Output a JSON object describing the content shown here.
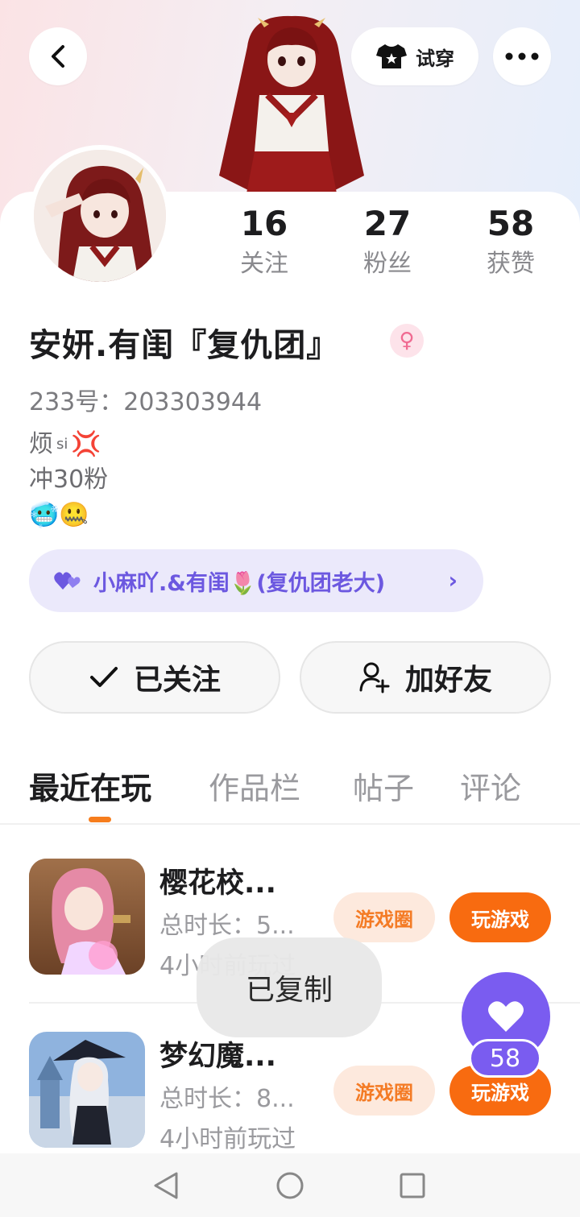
{
  "header": {
    "try_on_label": "试穿"
  },
  "stats": [
    {
      "value": "16",
      "label": "关注"
    },
    {
      "value": "27",
      "label": "粉丝"
    },
    {
      "value": "58",
      "label": "获赞"
    }
  ],
  "profile": {
    "name": "安妍.有闺『复仇团』",
    "gender_symbol": "♀",
    "uid": "233号：203303944",
    "bio_line1_text": "烦",
    "bio_line1_sup": "si",
    "bio_line1_emoji": "💢",
    "bio_line2": "冲30粉",
    "bio_line3_emoji": "🥶🤐"
  },
  "relation": {
    "label": "小麻吖.&有闺🌷(复仇团老大)",
    "chevron": "›"
  },
  "actions": {
    "followed_label": "已关注",
    "add_friend_label": "加好友"
  },
  "tabs": [
    "最近在玩",
    "作品栏",
    "帖子",
    "评论"
  ],
  "games": [
    {
      "title": "樱花校...",
      "time": "总时长：5...",
      "last_played": "4小时前玩过",
      "circle_label": "游戏圈",
      "play_label": "玩游戏"
    },
    {
      "title": "梦幻魔...",
      "time": "总时长：8...",
      "last_played": "4小时前玩过",
      "circle_label": "游戏圈",
      "play_label": "玩游戏"
    }
  ],
  "toast": "已复制",
  "like_count": "58",
  "colors": {
    "accent_orange": "#f86b10",
    "accent_purple": "#7a5cf0",
    "relation_bg": "#ebe9fb"
  }
}
